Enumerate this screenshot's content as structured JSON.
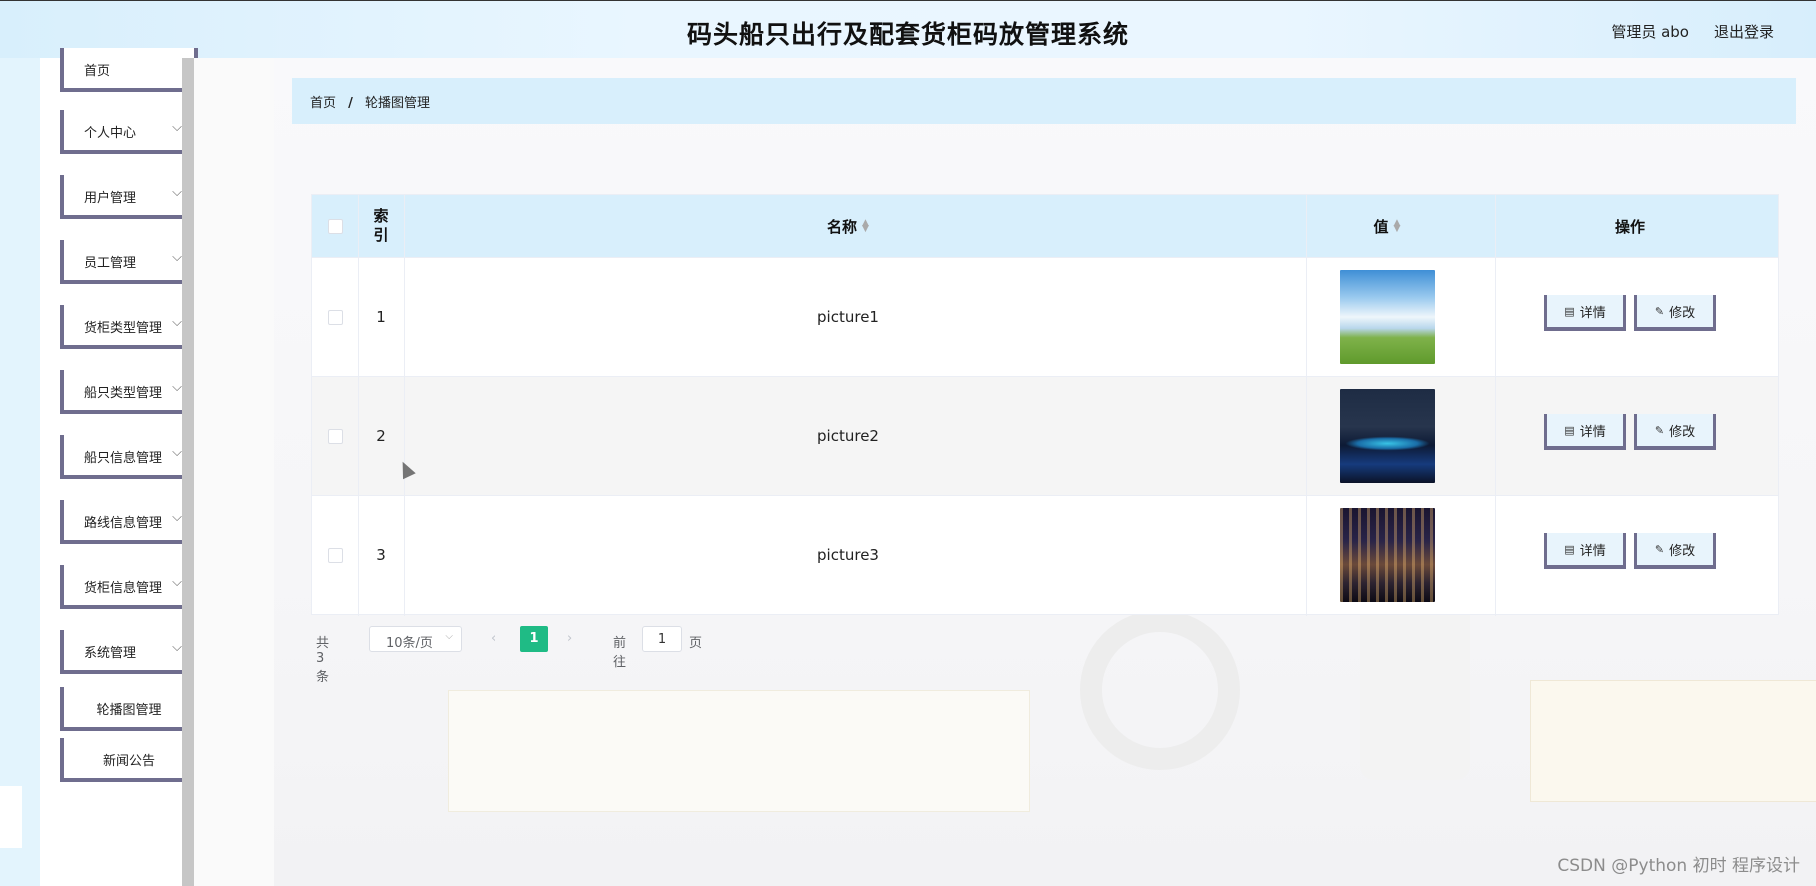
{
  "header": {
    "title": "码头船只出行及配套货柜码放管理系统",
    "admin_label": "管理员 abo",
    "logout_label": "退出登录"
  },
  "sidebar": {
    "items": [
      {
        "label": "首页",
        "has_arrow": false
      },
      {
        "label": "个人中心",
        "has_arrow": true
      },
      {
        "label": "用户管理",
        "has_arrow": true
      },
      {
        "label": "员工管理",
        "has_arrow": true
      },
      {
        "label": "货柜类型管理",
        "has_arrow": true
      },
      {
        "label": "船只类型管理",
        "has_arrow": true
      },
      {
        "label": "船只信息管理",
        "has_arrow": true
      },
      {
        "label": "路线信息管理",
        "has_arrow": true
      },
      {
        "label": "货柜信息管理",
        "has_arrow": true
      },
      {
        "label": "系统管理",
        "has_arrow": true
      },
      {
        "label": "轮播图管理",
        "has_arrow": false
      },
      {
        "label": "新闻公告",
        "has_arrow": false
      }
    ]
  },
  "breadcrumb": {
    "home": "首页",
    "separator": "/",
    "current": "轮播图管理"
  },
  "table": {
    "columns": {
      "index": "索\n引",
      "name": "名称",
      "value": "值",
      "actions": "操作"
    },
    "rows": [
      {
        "index": "1",
        "name": "picture1",
        "image": "sky-grass-landscape"
      },
      {
        "index": "2",
        "name": "picture2",
        "image": "night-bridge-lights"
      },
      {
        "index": "3",
        "name": "picture3",
        "image": "night-city-skyline"
      }
    ],
    "detail_label": "详情",
    "edit_label": "修改"
  },
  "pagination": {
    "total": "共 3 条",
    "page_size": "10条/页",
    "current_page": "1",
    "goto_label": "前往",
    "goto_value": "1",
    "page_suffix": "页"
  },
  "watermark": "CSDN @Python 初时 程序设计",
  "colors": {
    "header_bg": "#d8effc",
    "accent_green": "#1fbb85",
    "button_border": "#6f6d8e"
  }
}
